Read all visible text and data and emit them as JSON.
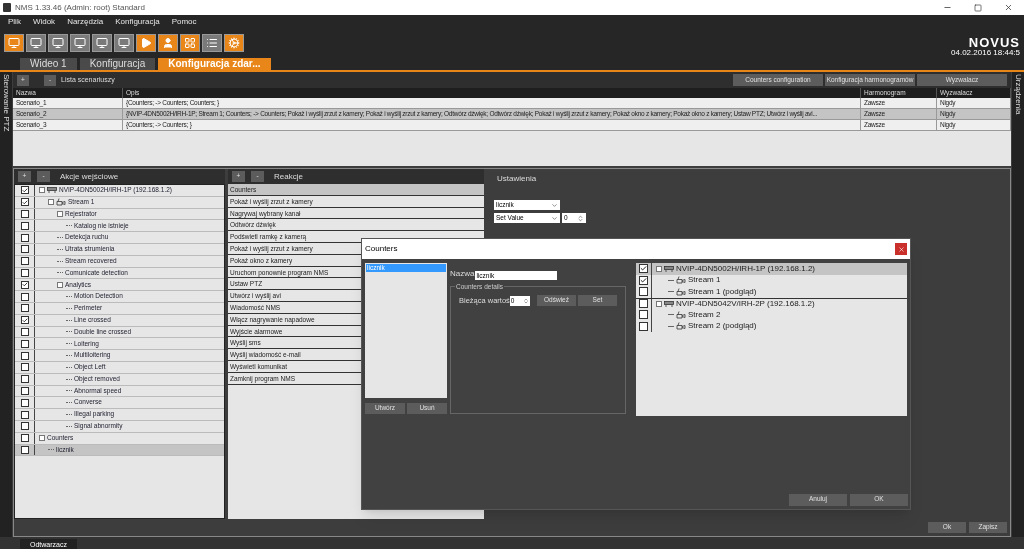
{
  "window": {
    "title": "NMS 1.33.46 (Admin: root) Standard"
  },
  "menu": [
    "Plik",
    "Widok",
    "Narzędzia",
    "Konfiguracja",
    "Pomoc"
  ],
  "toolbar": [
    {
      "kind": "monitor",
      "highlighted": true
    },
    {
      "kind": "monitor",
      "highlighted": false
    },
    {
      "kind": "monitor",
      "highlighted": false
    },
    {
      "kind": "monitor",
      "highlighted": false
    },
    {
      "kind": "monitor",
      "highlighted": false
    },
    {
      "kind": "monitor",
      "highlighted": false
    },
    {
      "kind": "play",
      "highlighted": true
    },
    {
      "kind": "person",
      "highlighted": true
    },
    {
      "kind": "grid",
      "highlighted": true
    },
    {
      "kind": "list",
      "highlighted": false
    },
    {
      "kind": "gears",
      "highlighted": true
    }
  ],
  "brand": {
    "logo": "NOVUS",
    "datetime": "04.02.2016 18:44:5"
  },
  "tabs": [
    {
      "label": "Wideo 1",
      "selected": false
    },
    {
      "label": "Konfiguracja",
      "selected": false
    },
    {
      "label": "Konfiguracja zdar...",
      "selected": true
    }
  ],
  "side_panels": {
    "left": "Sterowanie PTZ",
    "right": "Urządzenia"
  },
  "scenarios": {
    "add": "+",
    "remove": "-",
    "title": "Lista scenariuszy",
    "buttons": [
      "Counters configuration",
      "Konfiguracja harmonogramów",
      "Wyzwalacz"
    ],
    "columns": [
      "Nazwa",
      "Opis",
      "Harmonogram",
      "Wyzwalacz"
    ],
    "rows": [
      {
        "cells": [
          "Scenario_1",
          "{Counters; -> Counters; Counters; }",
          "Zawsze",
          "Nigdy"
        ],
        "selected": false
      },
      {
        "cells": [
          "Scenario_2",
          "{NVIP-4DN5002H/IRH-1P; Stream 1; Counters; -> Counters; Pokaż i wyślij zrzut z kamery; Pokaż i wyślij zrzut z kamery; Odtwórz dźwięk; Odtwórz dźwięk; Pokaż i wyślij zrzut z kamery; Pokaż okno z kamery; Pokaż okno z kamery; Ustaw PTZ; Utwórz i wyślij avi...",
          "Zawsze",
          "Nigdy"
        ],
        "selected": true
      },
      {
        "cells": [
          "Scenario_3",
          "{Counters; -> Counters; }",
          "Zawsze",
          "Nigdy"
        ],
        "selected": false
      }
    ]
  },
  "inputs_panel": {
    "add": "+",
    "remove": "-",
    "title": "Akcje wejściowe",
    "tree": [
      {
        "label": "NVIP-4DN5002H/IRH-1P (192.168.1.2)",
        "kind": "device",
        "checked": true,
        "selected": false,
        "children": [
          {
            "label": "Stream 1",
            "kind": "stream",
            "checked": true,
            "selected": false,
            "children": [
              {
                "label": "Rejestrator",
                "checked": false,
                "selected": false,
                "children": [
                  {
                    "label": "Katalog nie istnieje",
                    "checked": false,
                    "selected": false
                  }
                ]
              },
              {
                "label": "Detekcja ruchu",
                "checked": false,
                "selected": false
              },
              {
                "label": "Utrata strumienia",
                "checked": false,
                "selected": false
              },
              {
                "label": "Stream recovered",
                "checked": false,
                "selected": false
              },
              {
                "label": "Comunicate detection",
                "checked": false,
                "selected": false
              },
              {
                "label": "Analytics",
                "checked": true,
                "selected": false,
                "children": [
                  {
                    "label": "Motion Detection",
                    "checked": false,
                    "selected": false
                  },
                  {
                    "label": "Perimeter",
                    "checked": false,
                    "selected": false
                  },
                  {
                    "label": "Line crossed",
                    "checked": true,
                    "selected": false
                  },
                  {
                    "label": "Double line crossed",
                    "checked": false,
                    "selected": false
                  },
                  {
                    "label": "Loitering",
                    "checked": false,
                    "selected": false
                  },
                  {
                    "label": "Multiloitering",
                    "checked": false,
                    "selected": false
                  },
                  {
                    "label": "Object Left",
                    "checked": false,
                    "selected": false
                  },
                  {
                    "label": "Object removed",
                    "checked": false,
                    "selected": false
                  },
                  {
                    "label": "Abnormal speed",
                    "checked": false,
                    "selected": false
                  },
                  {
                    "label": "Converse",
                    "checked": false,
                    "selected": false
                  },
                  {
                    "label": "Illegal parking",
                    "checked": false,
                    "selected": false
                  },
                  {
                    "label": "Signal abnormity",
                    "checked": false,
                    "selected": false
                  }
                ]
              }
            ]
          }
        ]
      },
      {
        "label": "Counters",
        "checked": false,
        "selected": false,
        "children": [
          {
            "label": "licznik",
            "checked": false,
            "selected": true
          }
        ]
      }
    ]
  },
  "reactions_panel": {
    "add": "+",
    "remove": "-",
    "title": "Reakcje",
    "items": [
      {
        "label": "Counters",
        "selected": true
      },
      {
        "label": "Pokaż i wyślij zrzut z kamery",
        "selected": false
      },
      {
        "label": "Nagrywaj wybrany kanał",
        "selected": false
      },
      {
        "label": "Odtwórz dźwięk",
        "selected": false
      },
      {
        "label": "Podświetl ramkę z kamerą",
        "selected": false
      },
      {
        "label": "Pokaż i wyślij zrzut z kamery",
        "selected": false
      },
      {
        "label": "Pokaż okno z kamery",
        "selected": false
      },
      {
        "label": "Uruchom ponownie program NMS",
        "selected": false
      },
      {
        "label": "Ustaw PTZ",
        "selected": false
      },
      {
        "label": "Utwórz i wyślij avi",
        "selected": false
      },
      {
        "label": "Wiadomość NMS",
        "selected": false
      },
      {
        "label": "Włącz nagrywanie napadowe",
        "selected": false
      },
      {
        "label": "Wyjście alarmowe",
        "selected": false
      },
      {
        "label": "Wyślij sms",
        "selected": false
      },
      {
        "label": "Wyślij wiadomość e-mail",
        "selected": false
      },
      {
        "label": "Wyświetl komunikat",
        "selected": false
      },
      {
        "label": "Zamknij program NMS",
        "selected": false
      }
    ]
  },
  "settings_panel": {
    "title": "Ustawienia",
    "counter_select": "licznik",
    "operation_select": "Set Value",
    "value": "0"
  },
  "footer_buttons": [
    "Ok",
    "Zapisz"
  ],
  "bottom_tabs": [
    {
      "label": "Odtwarzacz",
      "selected": true
    }
  ],
  "dialog": {
    "title": "Counters",
    "counters": [
      {
        "label": "licznik",
        "selected": true
      }
    ],
    "list_buttons": [
      "Utwórz",
      "Usuń"
    ],
    "name_label": "Nazwa",
    "name_value": "licznik",
    "details_legend": "Counters details",
    "current_label": "Bieżąca wartoś",
    "current_value": "0",
    "detail_buttons": [
      "Odśwież",
      "Set"
    ],
    "tree": [
      {
        "label": "NVIP-4DN5002H/IRH-1P (192.168.1.2)",
        "kind": "device",
        "checked": true,
        "selected": true,
        "children": [
          {
            "label": "Stream 1",
            "kind": "stream",
            "checked": true,
            "selected": false
          },
          {
            "label": "Stream 1 (podgląd)",
            "kind": "stream",
            "checked": false,
            "selected": false
          }
        ]
      },
      {
        "label": "NVIP-4DN5042V/IRH-2P (192.168.1.2)",
        "kind": "device",
        "checked": false,
        "selected": false,
        "children": [
          {
            "label": "Stream 2",
            "kind": "stream",
            "checked": false,
            "selected": false
          },
          {
            "label": "Stream 2 (podgląd)",
            "kind": "stream",
            "checked": false,
            "selected": false
          }
        ]
      }
    ],
    "buttons": [
      "Anuluj",
      "OK"
    ]
  }
}
